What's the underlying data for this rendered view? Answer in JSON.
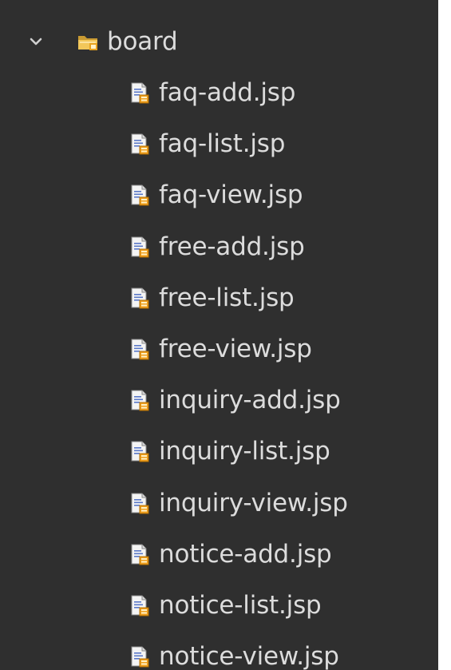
{
  "tree": {
    "folder": {
      "label": "board",
      "expanded": true,
      "twisty_icon": "chevron-down-icon",
      "icon": "folder-icon"
    },
    "files": [
      {
        "label": "faq-add.jsp",
        "icon": "jsp-file-icon"
      },
      {
        "label": "faq-list.jsp",
        "icon": "jsp-file-icon"
      },
      {
        "label": "faq-view.jsp",
        "icon": "jsp-file-icon"
      },
      {
        "label": "free-add.jsp",
        "icon": "jsp-file-icon"
      },
      {
        "label": "free-list.jsp",
        "icon": "jsp-file-icon"
      },
      {
        "label": "free-view.jsp",
        "icon": "jsp-file-icon"
      },
      {
        "label": "inquiry-add.jsp",
        "icon": "jsp-file-icon"
      },
      {
        "label": "inquiry-list.jsp",
        "icon": "jsp-file-icon"
      },
      {
        "label": "inquiry-view.jsp",
        "icon": "jsp-file-icon"
      },
      {
        "label": "notice-add.jsp",
        "icon": "jsp-file-icon"
      },
      {
        "label": "notice-list.jsp",
        "icon": "jsp-file-icon"
      },
      {
        "label": "notice-view.jsp",
        "icon": "jsp-file-icon"
      }
    ]
  },
  "colors": {
    "background": "#2f2f2f",
    "text": "#dcdcdc",
    "folder": "#e8b84a",
    "file_accent": "#f0a020"
  }
}
